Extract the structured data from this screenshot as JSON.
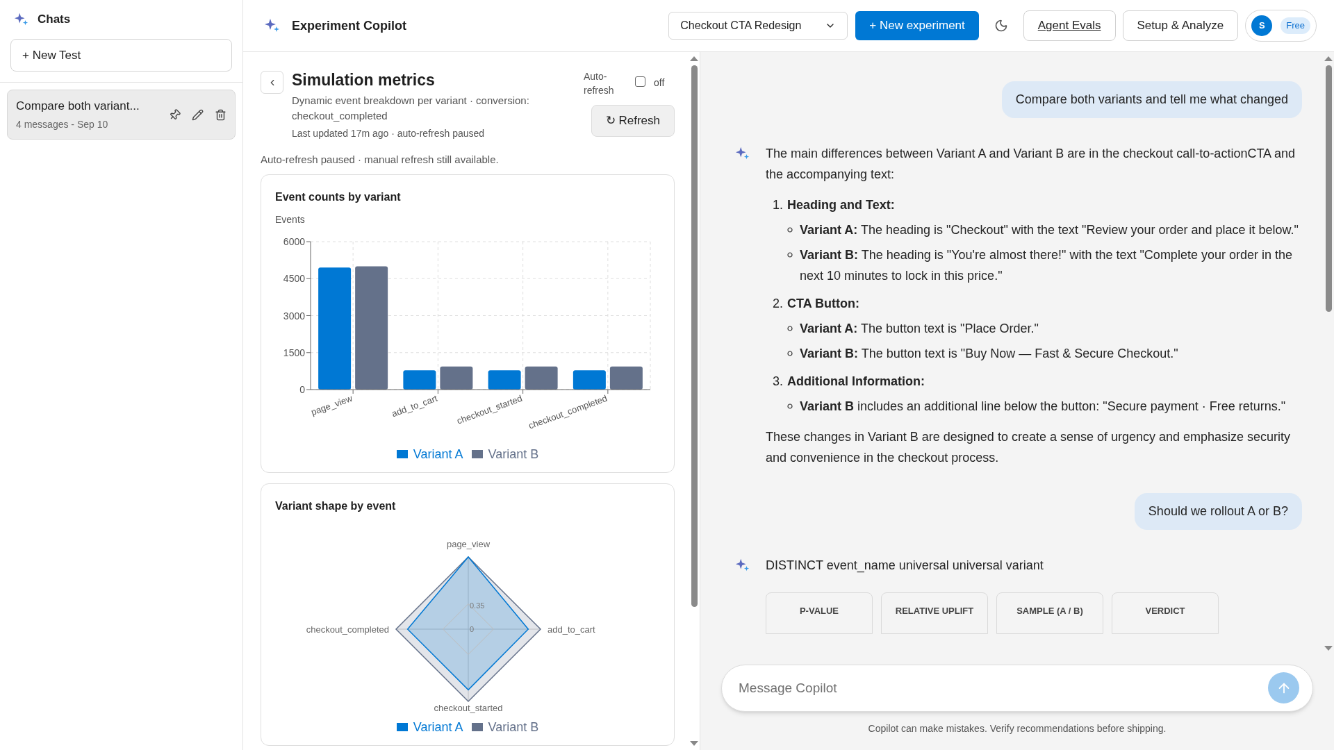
{
  "sidebar": {
    "title": "Chats",
    "new_button": "+ New Test",
    "chats": [
      {
        "title": "Compare both variant...",
        "meta": "4 messages - Sep 10",
        "selected": true
      }
    ]
  },
  "header": {
    "title": "Experiment Copilot",
    "experiment_select": "Checkout CTA Redesign",
    "new_button": "+ New experiment",
    "links": [
      {
        "label": "Agent Evals",
        "kind": "link"
      },
      {
        "label": "Setup & Analyze",
        "kind": "button"
      }
    ],
    "user": {
      "initial": "S",
      "plan": "Free"
    }
  },
  "metrics": {
    "title": "Simulation metrics",
    "subtitle": "Dynamic event breakdown per variant · conversion: checkout_completed",
    "updated": "Last updated 17m ago · auto-refresh paused",
    "auto_refresh": {
      "label": "Auto-refresh",
      "checked": false,
      "state": "off"
    },
    "refresh_button": "↻ Refresh",
    "notice": "Auto-refresh paused · manual refresh still available.",
    "bar_card": {
      "title": "Event counts by variant",
      "chart_data": {
        "type": "bar",
        "ylabel": "Events",
        "grid": true,
        "legend": true,
        "categories": [
          "page_view",
          "add_to_cart",
          "checkout_started",
          "checkout_completed"
        ],
        "series": [
          {
            "name": "Variant A",
            "color": "#0078d4",
            "values": [
              4950,
              780,
              780,
              780
            ]
          },
          {
            "name": "Variant B",
            "color": "#64718a",
            "values": [
              5000,
              940,
              940,
              940
            ]
          }
        ],
        "ylim": [
          0,
          6000
        ],
        "yticks": [
          0,
          1500,
          3000,
          4500,
          6000
        ]
      }
    },
    "radar_card": {
      "title": "Variant shape by event",
      "axes": [
        "page_view",
        "add_to_cart",
        "checkout_started",
        "checkout_completed"
      ],
      "ticks": [
        "0.35",
        "0"
      ],
      "legend": [
        {
          "label": "Variant A",
          "color": "#0078d4"
        },
        {
          "label": "Variant B",
          "color": "#64718a"
        }
      ]
    }
  },
  "chat": {
    "messages": [
      {
        "kind": "user",
        "text": "Compare both variants and tell me what changed"
      },
      {
        "kind": "assistant",
        "content": [
          {
            "kind": "paragraph",
            "text": "The main differences between Variant A and Variant B are in the checkout call-to-actionCTA and the accompanying text:"
          },
          {
            "kind": "numbered",
            "items": [
              {
                "number": "1.",
                "heading": "Heading and Text:",
                "bullets": [
                  "**Variant A:** The heading is \"Checkout\" with the text \"Review your order and place it below.\"",
                  "**Variant B:** The heading is \"You're almost there!\" with the text \"Complete your order in the next 10 minutes to lock in this price.\""
                ]
              },
              {
                "number": "2.",
                "heading": "CTA Button:",
                "bullets": [
                  "**Variant A:** The button text is \"Place Order.\"",
                  "**Variant B:** The button text is \"Buy Now — Fast & Secure Checkout.\""
                ]
              },
              {
                "number": "3.",
                "heading": "Additional Information:",
                "bullets": [
                  "**Variant B** includes an additional line below the button: \"Secure payment · Free returns.\""
                ]
              }
            ]
          },
          {
            "kind": "paragraph",
            "text": "These changes in Variant B are designed to create a sense of urgency and emphasize security and convenience in the checkout process."
          }
        ]
      },
      {
        "kind": "user",
        "text": "Should we rollout A or B?"
      },
      {
        "kind": "assistant",
        "content": [
          {
            "kind": "paragraph",
            "text": "DISTINCT event_name universal universal variant"
          },
          {
            "kind": "stat_headers",
            "items": [
              "P-VALUE",
              "RELATIVE UPLIFT",
              "SAMPLE (A / B)",
              "VERDICT"
            ]
          }
        ]
      }
    ],
    "composer": {
      "placeholder": "Message Copilot"
    },
    "disclaimer": "Copilot can make mistakes. Verify recommendations before shipping."
  }
}
